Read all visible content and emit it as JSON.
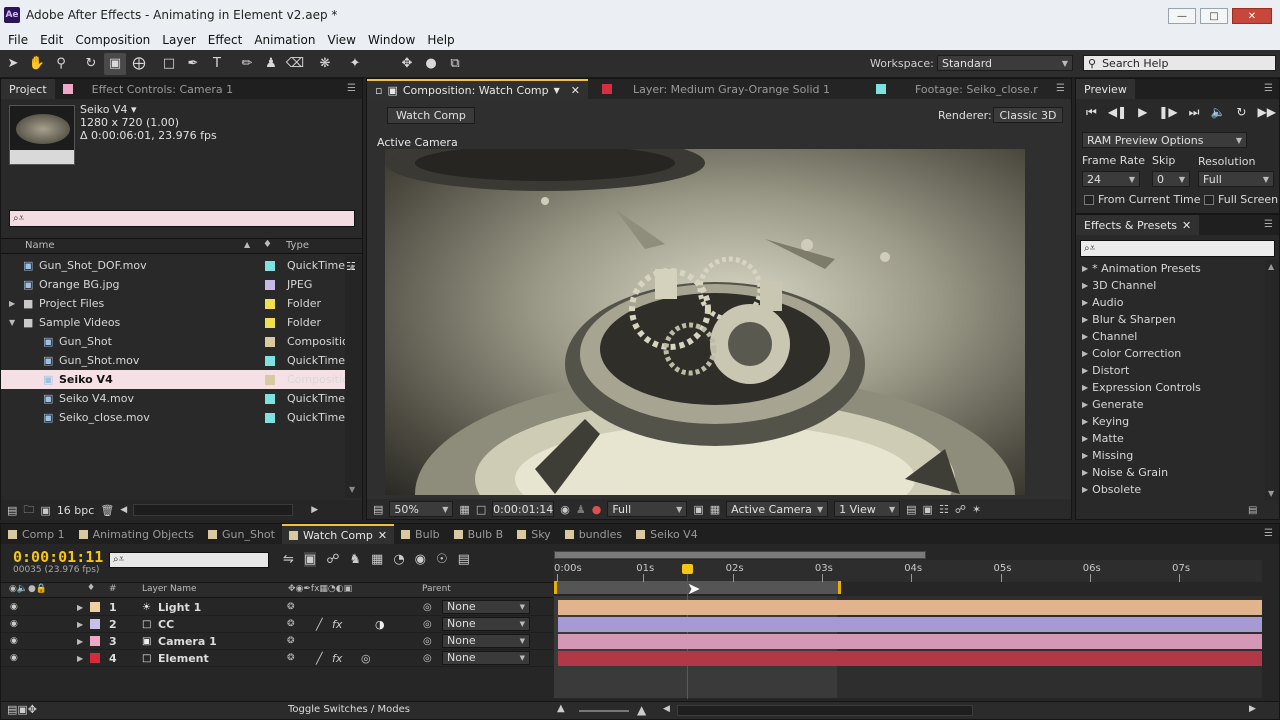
{
  "window": {
    "title": "Adobe After Effects - Animating in Element v2.aep *",
    "logo": "Ae",
    "buttons": [
      "minimize-icon",
      "maximize-icon",
      "close-icon"
    ]
  },
  "menu": [
    "File",
    "Edit",
    "Composition",
    "Layer",
    "Effect",
    "Animation",
    "View",
    "Window",
    "Help"
  ],
  "toolbar": {
    "workspace_label": "Workspace:",
    "workspace_value": "Standard",
    "search_placeholder": "Search Help"
  },
  "project": {
    "tab": "Project",
    "effect_controls_tab": "Effect Controls: Camera 1",
    "selected": {
      "name": "Seiko V4 ▾",
      "size": "1280 x 720 (1.00)",
      "duration": "Δ 0:00:06:01, 23.976 fps"
    },
    "search_placeholder": "⌕⩡",
    "col_name": "Name",
    "col_type": "Type",
    "items": [
      {
        "name": "Gun_Shot_DOF.mov",
        "type": "QuickTime",
        "color": "#7fe0e0",
        "indent": 0,
        "kind": "file"
      },
      {
        "name": "Orange BG.jpg",
        "type": "JPEG",
        "color": "#c8b8e8",
        "indent": 0,
        "kind": "file"
      },
      {
        "name": "Project Files",
        "type": "Folder",
        "color": "#f0e050",
        "indent": 0,
        "kind": "folder"
      },
      {
        "name": "Sample Videos",
        "type": "Folder",
        "color": "#f0e050",
        "indent": 0,
        "kind": "folder-open"
      },
      {
        "name": "Gun_Shot",
        "type": "Compositio",
        "color": "#d9c9a0",
        "indent": 1,
        "kind": "comp"
      },
      {
        "name": "Gun_Shot.mov",
        "type": "QuickTime",
        "color": "#7fe0e0",
        "indent": 1,
        "kind": "file"
      },
      {
        "name": "Seiko V4",
        "type": "Compositio",
        "color": "#d9c9a0",
        "indent": 1,
        "kind": "comp"
      },
      {
        "name": "Seiko V4.mov",
        "type": "QuickTime",
        "color": "#7fe0e0",
        "indent": 1,
        "kind": "file"
      },
      {
        "name": "Seiko_close.mov",
        "type": "QuickTime",
        "color": "#7fe0e0",
        "indent": 1,
        "kind": "file"
      }
    ],
    "bpc": "16 bpc"
  },
  "comp": {
    "tabs": [
      {
        "label": "Composition: Watch Comp",
        "color": "#ffffff"
      },
      {
        "label": "Layer: Medium Gray-Orange Solid 1",
        "color": "#d63040"
      },
      {
        "label": "Footage: Seiko_close.r",
        "color": "#7fe0e0"
      }
    ],
    "subtab": "Watch Comp",
    "renderer_label": "Renderer:",
    "renderer_value": "Classic 3D",
    "view_label": "Active Camera",
    "footer": {
      "zoom": "50%",
      "timecode": "0:00:01:14",
      "resolution": "Full",
      "camera": "Active Camera",
      "views": "1 View"
    }
  },
  "preview": {
    "tab": "Preview",
    "ram": "RAM Preview Options",
    "frame_rate_label": "Frame Rate",
    "skip_label": "Skip",
    "resolution_label": "Resolution",
    "frame_rate": "24",
    "skip": "0",
    "resolution": "Full",
    "from_current": "From Current Time",
    "full_screen": "Full Screen"
  },
  "effects": {
    "tab": "Effects & Presets",
    "search_placeholder": "⌕⩡",
    "items": [
      "* Animation Presets",
      "3D Channel",
      "Audio",
      "Blur & Sharpen",
      "Channel",
      "Color Correction",
      "Distort",
      "Expression Controls",
      "Generate",
      "Keying",
      "Matte",
      "Missing",
      "Noise & Grain",
      "Obsolete"
    ]
  },
  "timeline": {
    "tabs": [
      {
        "label": "Comp 1",
        "color": "#d9c9a0"
      },
      {
        "label": "Animating Objects",
        "color": "#d9c9a0"
      },
      {
        "label": "Gun_Shot",
        "color": "#d9c9a0"
      },
      {
        "label": "Watch Comp",
        "color": "#d9c9a0"
      },
      {
        "label": "Bulb",
        "color": "#d9c9a0"
      },
      {
        "label": "Bulb B",
        "color": "#d9c9a0"
      },
      {
        "label": "Sky",
        "color": "#d9c9a0"
      },
      {
        "label": "bundles",
        "color": "#d9c9a0"
      },
      {
        "label": "Seiko V4",
        "color": "#d9c9a0"
      }
    ],
    "timecode": "0:00:01:11",
    "frames": "00035 (23.976 fps)",
    "search_placeholder": "⌕⩡",
    "col_num": "#",
    "col_layer": "Layer Name",
    "col_parent": "Parent",
    "ruler": [
      "0:00s",
      "01s",
      "02s",
      "03s",
      "04s",
      "05s",
      "06s",
      "07s"
    ],
    "layers": [
      {
        "num": "1",
        "name": "Light 1",
        "color": "#f0d0a0",
        "bar": "#e2b48e",
        "icon": "bulb-icon",
        "fx": false,
        "parent": "None"
      },
      {
        "num": "2",
        "name": "CC",
        "color": "#c8c0e8",
        "bar": "#a79ad2",
        "icon": "solid-icon",
        "fx": true,
        "parent": "None"
      },
      {
        "num": "3",
        "name": "Camera 1",
        "color": "#f0a8c8",
        "bar": "#d497b5",
        "icon": "camera-icon",
        "fx": false,
        "parent": "None"
      },
      {
        "num": "4",
        "name": "Element",
        "color": "#d82a3a",
        "bar": "#b03847",
        "icon": "solid-icon",
        "fx": true,
        "parent": "None"
      }
    ],
    "toggle_label": "Toggle Switches / Modes"
  }
}
